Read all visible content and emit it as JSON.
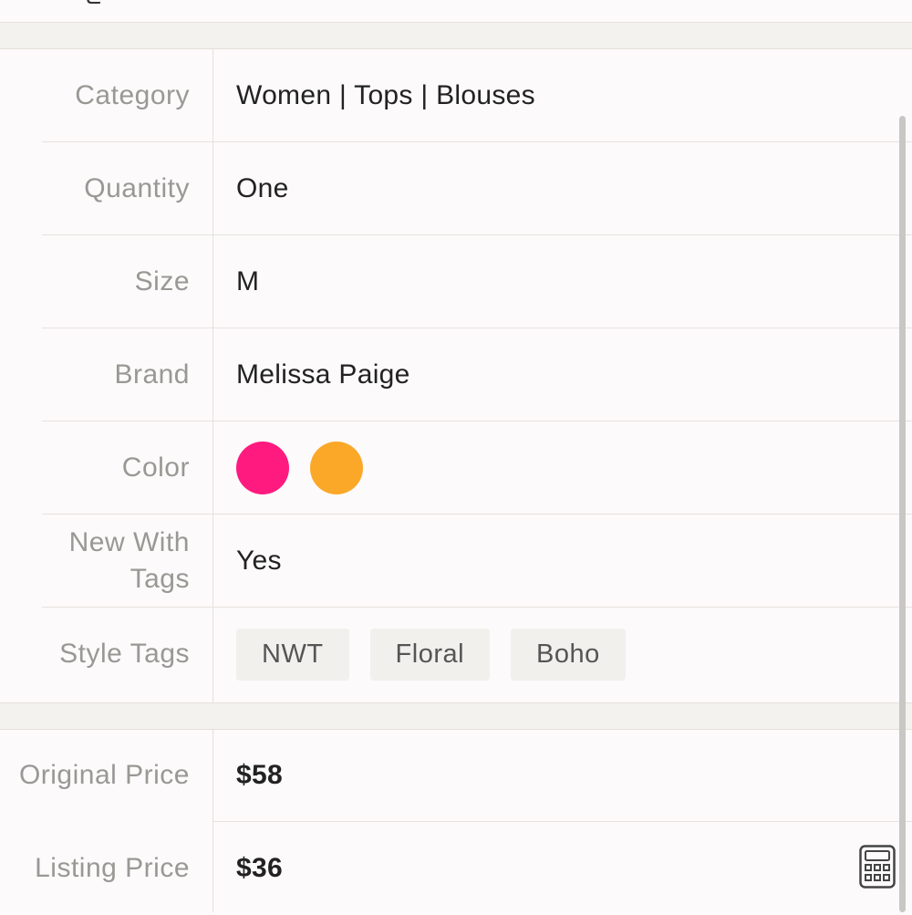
{
  "details": {
    "rows": [
      {
        "label": "Category",
        "value": "Women | Tops | Blouses"
      },
      {
        "label": "Quantity",
        "value": "One"
      },
      {
        "label": "Size",
        "value": "M"
      },
      {
        "label": "Brand",
        "value": "Melissa Paige"
      },
      {
        "label": "Color",
        "swatches": [
          "#ff1a80",
          "#fba829"
        ]
      },
      {
        "label": "New With Tags",
        "value": "Yes"
      },
      {
        "label": "Style Tags",
        "tags": [
          "NWT",
          "Floral",
          "Boho"
        ]
      }
    ]
  },
  "pricing": {
    "original_label": "Original Price",
    "original_value": "$58",
    "listing_label": "Listing Price",
    "listing_value": "$36"
  },
  "icons": {
    "calculator": "calculator-icon"
  }
}
